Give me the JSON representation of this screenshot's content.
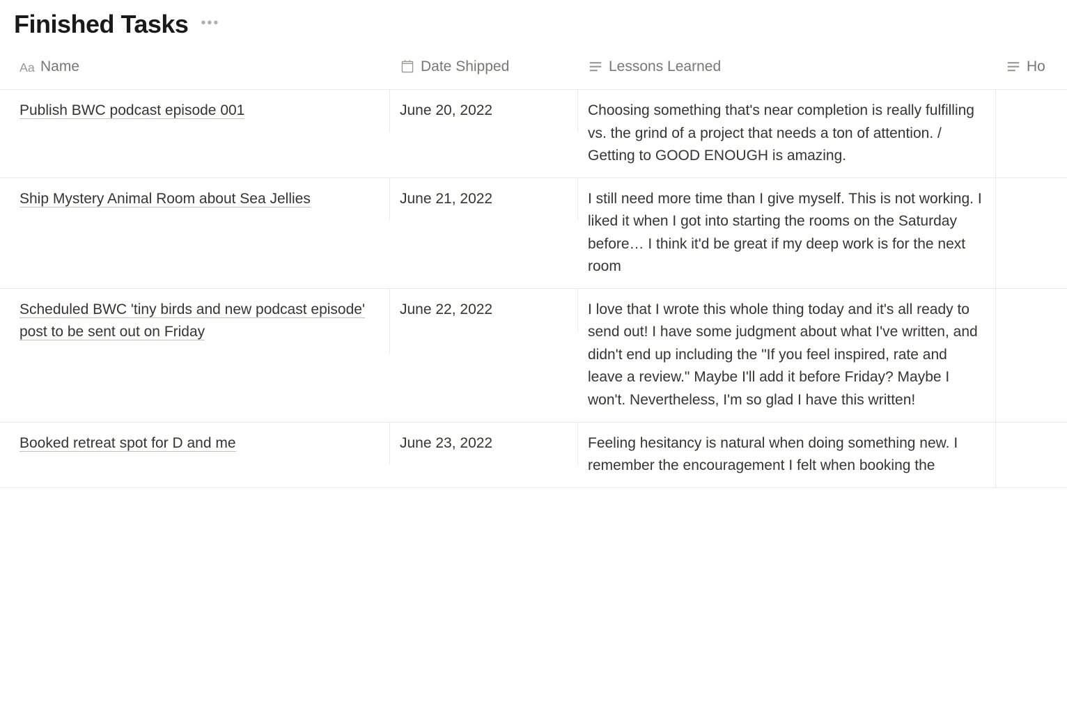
{
  "header": {
    "title": "Finished Tasks"
  },
  "columns": {
    "name": "Name",
    "date": "Date Shipped",
    "lessons": "Lessons Learned",
    "how": "Ho"
  },
  "rows": [
    {
      "name": "Publish BWC podcast episode 001",
      "date": "June 20, 2022",
      "lessons": "Choosing something that's near completion is really fulfilling vs. the grind of a project that needs a ton of attention. / Getting to GOOD ENOUGH is amazing."
    },
    {
      "name": "Ship Mystery Animal Room about Sea Jellies",
      "date": "June 21, 2022",
      "lessons": "I still need more time than I give myself. This is not working. I liked it when I got into starting the rooms on the Saturday before… I think it'd be great if my deep work is for the next room"
    },
    {
      "name": "Scheduled BWC 'tiny birds and new podcast episode' post to be sent out on Friday",
      "date": "June 22, 2022",
      "lessons": "I love that I wrote this whole thing today and it's all ready to send out! I have some judgment about what I've written, and didn't end up including the \"If you feel inspired, rate and leave a review.\" Maybe I'll add it before Friday? Maybe I won't. Nevertheless, I'm so glad I have this written!"
    },
    {
      "name": "Booked retreat spot for D and me",
      "date": "June 23, 2022",
      "lessons": "Feeling hesitancy is natural when doing something new. I remember the encouragement I felt when booking the"
    }
  ]
}
